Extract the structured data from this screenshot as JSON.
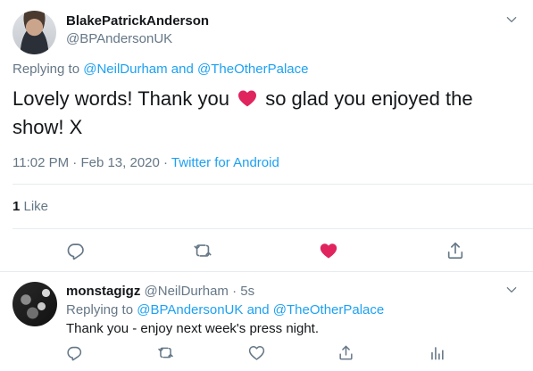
{
  "main_tweet": {
    "display_name": "BlakePatrickAnderson",
    "handle": "@BPAndersonUK",
    "replying_prefix": "Replying to ",
    "reply_to_1": "@NeilDurham",
    "reply_and": " and ",
    "reply_to_2": "@TheOtherPalace",
    "text_part1": "Lovely words! Thank you",
    "text_part2": " so glad you enjoyed the",
    "text_line2": "show! X",
    "time": "11:02 PM",
    "sep": " · ",
    "date": "Feb 13, 2020",
    "source": "Twitter for Android",
    "likes_count": "1",
    "likes_label": " Like"
  },
  "reply_tweet": {
    "display_name": "monstagigz",
    "handle": "@NeilDurham",
    "sep": " · ",
    "time_ago": "5s",
    "replying_prefix": "Replying to ",
    "reply_to_1": "@BPAndersonUK",
    "reply_and": " and ",
    "reply_to_2": "@TheOtherPalace",
    "text": "Thank you - enjoy next week's press night."
  },
  "colors": {
    "link": "#1da1f2",
    "muted": "#657786",
    "heart": "#e0245e",
    "divider": "#e6ecf0"
  },
  "icons": [
    "chevron-down-icon",
    "heart-icon",
    "reply-icon",
    "retweet-icon",
    "like-icon",
    "share-icon",
    "analytics-icon"
  ]
}
